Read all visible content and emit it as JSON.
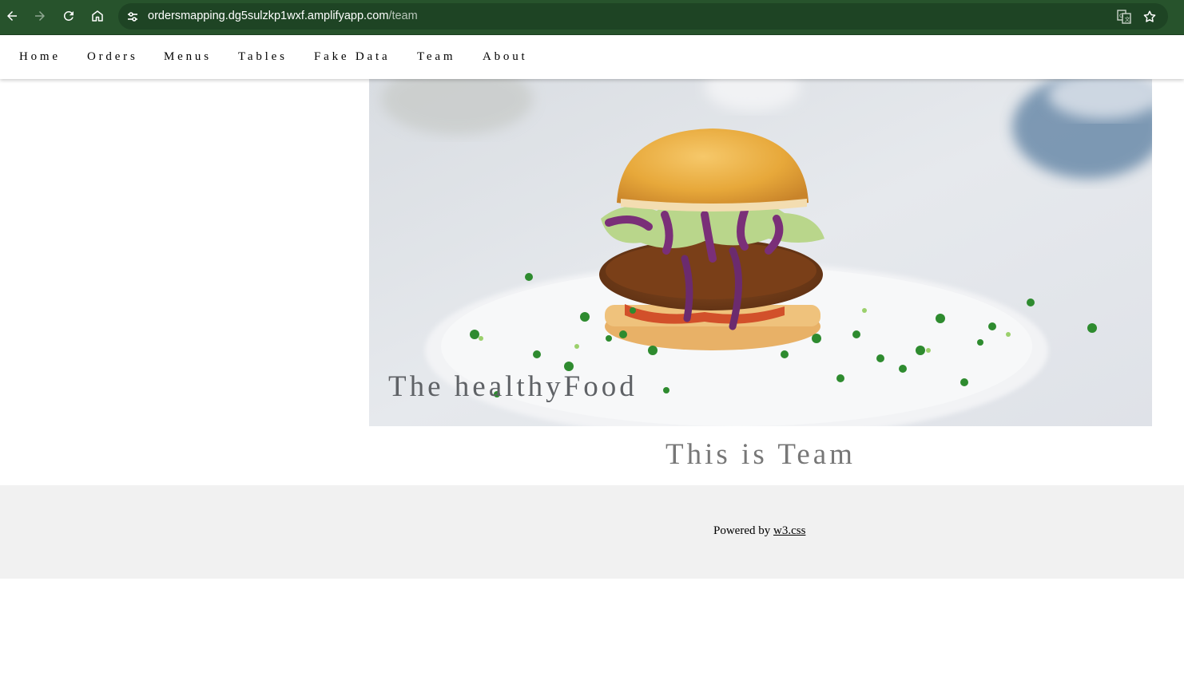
{
  "browser": {
    "url_host": "ordersmapping.dg5sulzkp1wxf.amplifyapp.com",
    "url_path": "/team",
    "icons": [
      "back-icon",
      "forward-icon",
      "reload-icon",
      "home-icon",
      "site-info-icon",
      "translate-icon",
      "bookmark-star-icon"
    ]
  },
  "nav": {
    "items": [
      "Home",
      "Orders",
      "Menus",
      "Tables",
      "Fake Data",
      "Team",
      "About"
    ]
  },
  "hero": {
    "caption": "The healthyFood"
  },
  "main": {
    "heading": "This is Team"
  },
  "footer": {
    "powered_by": "Powered by",
    "link": "w3.css"
  },
  "colors": {
    "chrome_bg": "#27532c",
    "omnibox_bg": "#1e4424",
    "footer_bg": "#f1f1f1",
    "heading_text": "#777777"
  }
}
